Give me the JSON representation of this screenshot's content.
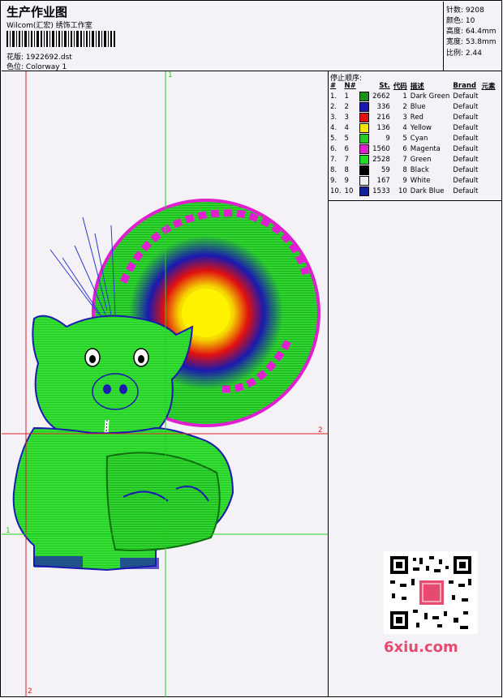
{
  "header": {
    "title": "生产作业图",
    "subtitle": "Wilcom(汇宏) 绣饰工作室",
    "design_label": "花版:",
    "design_value": "1922692.dst",
    "colorway_label": "色位:",
    "colorway_value": "Colorway 1"
  },
  "stats": [
    {
      "label": "针数:",
      "value": "9208"
    },
    {
      "label": "颜色:",
      "value": "10"
    },
    {
      "label": "高度:",
      "value": "64.4mm"
    },
    {
      "label": "宽度:",
      "value": "53.8mm"
    },
    {
      "label": "比例:",
      "value": "2.44"
    }
  ],
  "stop_sequence": {
    "title": "停止顺序:",
    "columns": [
      "#",
      "N#",
      "St.",
      "代码",
      "描述",
      "Brand",
      "元素"
    ],
    "rows": [
      {
        "idx": "1.",
        "n": "1",
        "color": "#1a8f1a",
        "st": "2662",
        "code": "1",
        "desc": "Dark Green",
        "brand": "Default"
      },
      {
        "idx": "2.",
        "n": "2",
        "color": "#1a1ab0",
        "st": "336",
        "code": "2",
        "desc": "Blue",
        "brand": "Default"
      },
      {
        "idx": "3.",
        "n": "3",
        "color": "#e01010",
        "st": "216",
        "code": "3",
        "desc": "Red",
        "brand": "Default"
      },
      {
        "idx": "4.",
        "n": "4",
        "color": "#f5e600",
        "st": "136",
        "code": "4",
        "desc": "Yellow",
        "brand": "Default"
      },
      {
        "idx": "5.",
        "n": "5",
        "color": "#22cc22",
        "st": "9",
        "code": "5",
        "desc": "Cyan",
        "brand": "Default"
      },
      {
        "idx": "6.",
        "n": "6",
        "color": "#e020d0",
        "st": "1560",
        "code": "6",
        "desc": "Magenta",
        "brand": "Default"
      },
      {
        "idx": "7.",
        "n": "7",
        "color": "#22dd22",
        "st": "2528",
        "code": "7",
        "desc": "Green",
        "brand": "Default"
      },
      {
        "idx": "8.",
        "n": "8",
        "color": "#000000",
        "st": "59",
        "code": "8",
        "desc": "Black",
        "brand": "Default"
      },
      {
        "idx": "9.",
        "n": "9",
        "color": "#eeeeee",
        "st": "167",
        "code": "9",
        "desc": "White",
        "brand": "Default"
      },
      {
        "idx": "10.",
        "n": "10",
        "color": "#1020a0",
        "st": "1533",
        "code": "10",
        "desc": "Dark Blue",
        "brand": "Default"
      }
    ]
  },
  "canvas": {
    "guide_labels": {
      "v_green": "1",
      "h_red": "2",
      "h_green": "1",
      "v_red": "2"
    },
    "guide_colors": {
      "green": "#20d020",
      "red": "#e02020"
    }
  },
  "watermark": {
    "text": "6xiu.com",
    "color": "#e64b6f"
  }
}
